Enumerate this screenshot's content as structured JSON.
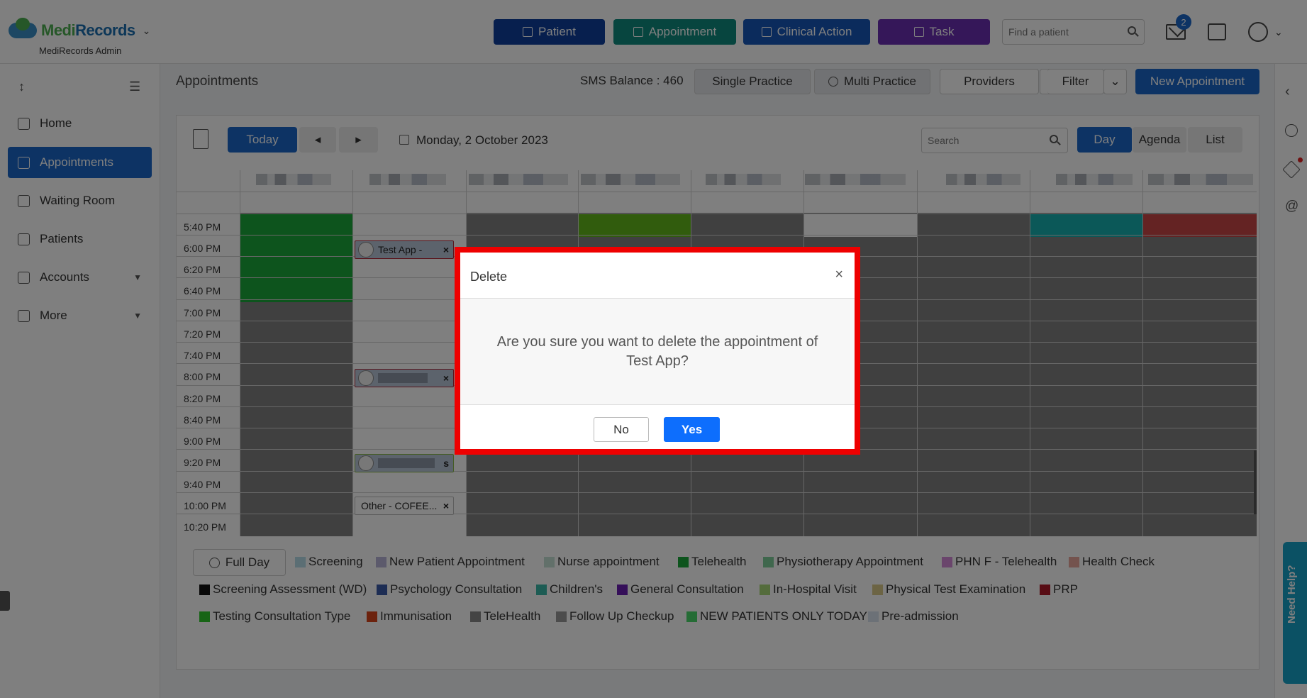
{
  "app": {
    "brand_part1": "Medi",
    "brand_part2": "Records",
    "caret": "⌄",
    "subtitle": "MediRecords Admin"
  },
  "header": {
    "buttons": [
      {
        "label": "Patient",
        "color": "#0e3f9c"
      },
      {
        "label": "Appointment",
        "color": "#0f8a7f"
      },
      {
        "label": "Clinical Action",
        "color": "#1656b8"
      },
      {
        "label": "Task",
        "color": "#6a2fb3"
      }
    ],
    "search_placeholder": "Find a patient",
    "mail_badge": "2"
  },
  "sidebar": {
    "items": [
      {
        "label": "Home",
        "icon": "home-icon"
      },
      {
        "label": "Appointments",
        "icon": "calendar-icon"
      },
      {
        "label": "Waiting Room",
        "icon": "waiting-room-icon"
      },
      {
        "label": "Patients",
        "icon": "patients-icon"
      },
      {
        "label": "Accounts",
        "icon": "folder-icon"
      },
      {
        "label": "More",
        "icon": "more-icon"
      }
    ]
  },
  "toolbar": {
    "title": "Appointments",
    "sms_balance": "SMS Balance : 460",
    "single_practice": "Single Practice",
    "multi_practice": "Multi Practice",
    "providers": "Providers",
    "filter": "Filter",
    "new_appointment": "New Appointment"
  },
  "calendar": {
    "today": "Today",
    "prev": "◂",
    "next": "▸",
    "date": "Monday, 2 October 2023",
    "search_placeholder": "Search",
    "views": [
      "Day",
      "Agenda",
      "List"
    ],
    "times": [
      "5:40 PM",
      "6:00 PM",
      "6:20 PM",
      "6:40 PM",
      "7:00 PM",
      "7:20 PM",
      "7:40 PM",
      "8:00 PM",
      "8:20 PM",
      "8:40 PM",
      "9:00 PM",
      "9:20 PM",
      "9:40 PM",
      "10:00 PM",
      "10:20 PM"
    ],
    "appointments": [
      {
        "label": "Test App -",
        "close": "×"
      },
      {
        "label": "",
        "close": "×"
      },
      {
        "label": "s",
        "close": ""
      },
      {
        "label": "Other - COFEE...",
        "close": "×"
      }
    ]
  },
  "legend": {
    "full_day": "Full Day",
    "items": [
      {
        "label": "Screening",
        "color": "#b7dde8"
      },
      {
        "label": "New Patient Appointment",
        "color": "#b9b4d8"
      },
      {
        "label": "Nurse appointment",
        "color": "#c5e0d5"
      },
      {
        "label": "Telehealth",
        "color": "#1aa83a"
      },
      {
        "label": "Physiotherapy Appointment",
        "color": "#7fcf9a"
      },
      {
        "label": "PHN F - Telehealth",
        "color": "#d58ad8"
      },
      {
        "label": "Health Check",
        "color": "#e8a79c"
      },
      {
        "label": "Screening Assessment (WD)",
        "color": "#111111"
      },
      {
        "label": "Psychology Consultation",
        "color": "#3a5ba8"
      },
      {
        "label": "Children's",
        "color": "#3ab8a8"
      },
      {
        "label": "General Consultation",
        "color": "#6a1fb3"
      },
      {
        "label": "In-Hospital Visit",
        "color": "#a8d878"
      },
      {
        "label": "Physical Test Examination",
        "color": "#d8c888"
      },
      {
        "label": "PRP",
        "color": "#b01a2a"
      },
      {
        "label": "Testing Consultation Type",
        "color": "#2ec82a"
      },
      {
        "label": "Immunisation",
        "color": "#d8441a"
      },
      {
        "label": "TeleHealth",
        "color": "#888888"
      },
      {
        "label": "Follow Up Checkup",
        "color": "#999999"
      },
      {
        "label": "NEW PATIENTS ONLY TODAY",
        "color": "#4ad86a"
      },
      {
        "label": "Pre-admission",
        "color": "#d8e2ee"
      }
    ]
  },
  "help": {
    "label": "Need Help?"
  },
  "modal": {
    "title": "Delete",
    "close": "×",
    "message": "Are you sure you want to delete the appointment of Test App?",
    "no": "No",
    "yes": "Yes"
  }
}
